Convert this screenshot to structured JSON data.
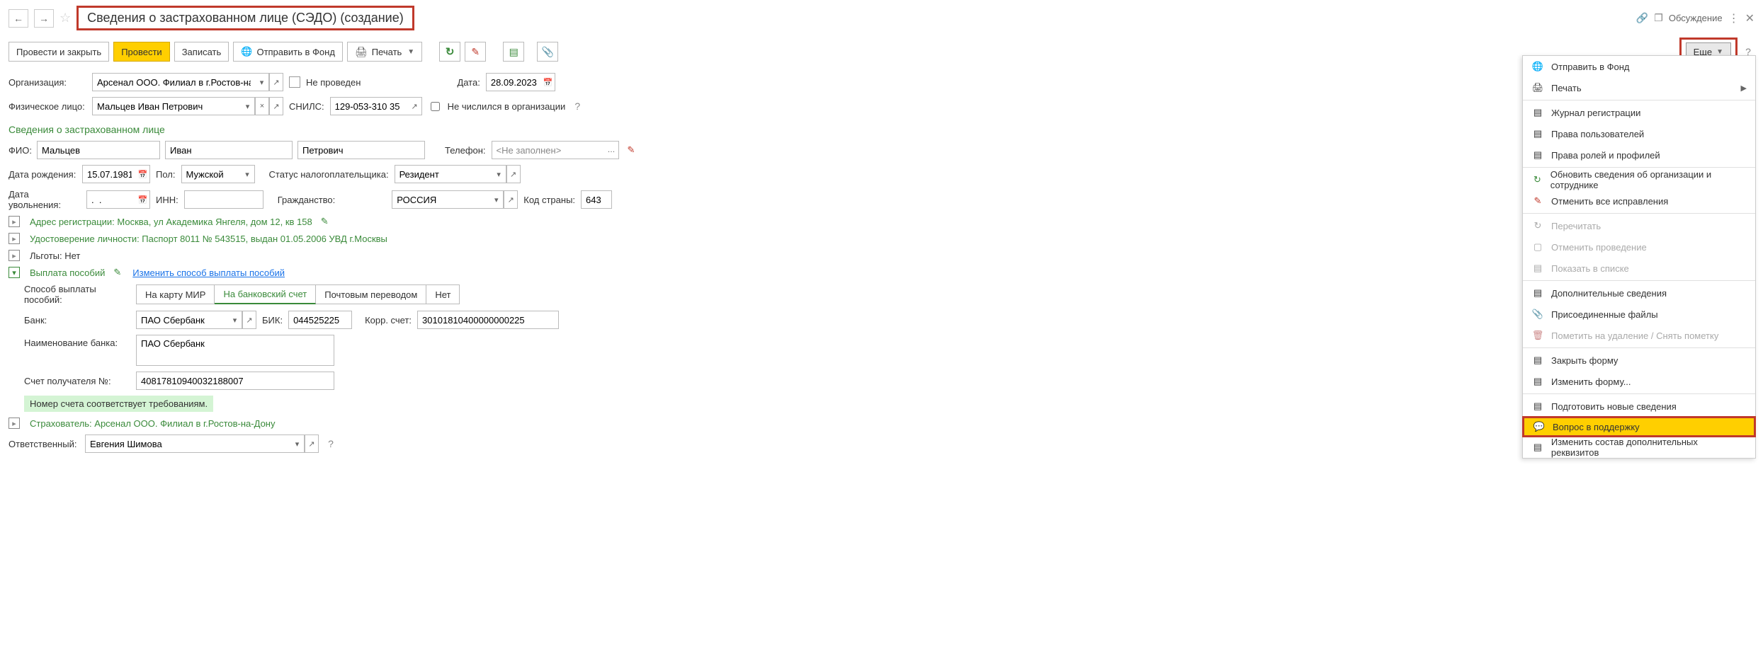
{
  "title": "Сведения о застрахованном лице (СЭДО) (создание)",
  "discuss": "Обсуждение",
  "toolbar": {
    "post_close": "Провести и закрыть",
    "post": "Провести",
    "write": "Записать",
    "send_fund": "Отправить в Фонд",
    "print": "Печать",
    "more": "Еще"
  },
  "org": {
    "label": "Организация:",
    "value": "Арсенал ООО. Филиал в г.Ростов-на-Дону",
    "not_posted_label": "Не проведен",
    "date_label": "Дата:",
    "date_value": "28.09.2023"
  },
  "person": {
    "label": "Физическое лицо:",
    "value": "Мальцев Иван Петрович",
    "snils_label": "СНИЛС:",
    "snils_value": "129-053-310 35",
    "not_in_org_label": "Не числился в организации"
  },
  "section1_title": "Сведения о застрахованном лице",
  "fio": {
    "label": "ФИО:",
    "last": "Мальцев",
    "first": "Иван",
    "middle": "Петрович",
    "phone_label": "Телефон:",
    "phone_placeholder": "<Не заполнен>"
  },
  "birth": {
    "label": "Дата рождения:",
    "value": "15.07.1981",
    "sex_label": "Пол:",
    "sex_value": "Мужской",
    "tax_status_label": "Статус налогоплательщика:",
    "tax_status_value": "Резидент"
  },
  "dismiss": {
    "label": "Дата увольнения:",
    "value": ".  .",
    "inn_label": "ИНН:",
    "inn_value": "",
    "citizenship_label": "Гражданство:",
    "citizenship_value": "РОССИЯ",
    "country_code_label": "Код страны:",
    "country_code_value": "643"
  },
  "addr_link": "Адрес регистрации: Москва, ул Академика Янгеля, дом 12, кв 158",
  "id_link": "Удостоверение личности: Паспорт 8011 № 543515, выдан 01.05.2006 УВД г.Москвы",
  "benefits_link": "Льготы: Нет",
  "payout_title": "Выплата пособий",
  "payout_change": "Изменить способ выплаты пособий",
  "payout_method_label": "Способ выплаты пособий:",
  "tabs": {
    "mir": "На карту МИР",
    "bank": "На банковский счет",
    "post": "Почтовым переводом",
    "none": "Нет"
  },
  "bank": {
    "label": "Банк:",
    "value": "ПАО Сбербанк",
    "bik_label": "БИК:",
    "bik_value": "044525225",
    "korr_label": "Корр. счет:",
    "korr_value": "30101810400000000225",
    "name_label": "Наименование банка:",
    "name_value": "ПАО Сбербанк",
    "acct_label": "Счет получателя №:",
    "acct_value": "40817810940032188007"
  },
  "validation_msg": "Номер счета соответствует требованиям.",
  "insurer_link": "Страхователь: Арсенал ООО. Филиал в г.Ростов-на-Дону",
  "responsible": {
    "label": "Ответственный:",
    "value": "Евгения Шимова"
  },
  "menu": {
    "send_fund": "Отправить в Фонд",
    "print": "Печать",
    "reg_log": "Журнал регистрации",
    "user_rights": "Права пользователей",
    "role_rights": "Права ролей и профилей",
    "reload_org": "Обновить сведения об организации и сотруднике",
    "cancel_fix": "Отменить все исправления",
    "reread": "Перечитать",
    "cancel_post": "Отменить проведение",
    "show_list": "Показать в списке",
    "extra_info": "Дополнительные сведения",
    "attached": "Присоединенные файлы",
    "mark_del": "Пометить на удаление / Снять пометку",
    "close_form": "Закрыть форму",
    "change_form": "Изменить форму...",
    "prepare_new": "Подготовить новые сведения",
    "support": "Вопрос в поддержку",
    "change_req": "Изменить состав дополнительных реквизитов"
  }
}
